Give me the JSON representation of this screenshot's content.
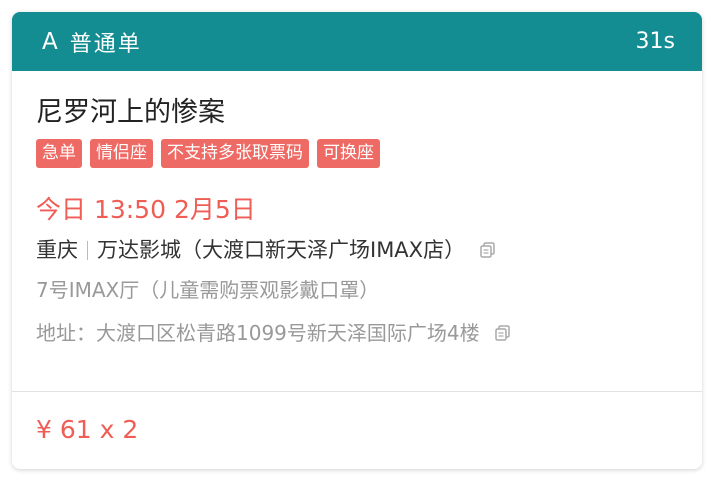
{
  "header": {
    "grade": "A",
    "order_type": "普通单",
    "countdown": "31s"
  },
  "movie": {
    "title": "尼罗河上的惨案"
  },
  "tags": [
    "急单",
    "情侣座",
    "不支持多张取票码",
    "可换座"
  ],
  "showtime": "今日 13:50 2月5日",
  "cinema": {
    "city": "重庆",
    "name": "万达影城（大渡口新天泽广场IMAX店）",
    "hall": "7号IMAX厅（儿童需购票观影戴口罩）",
    "address": "地址：大渡口区松青路1099号新天泽国际广场4楼"
  },
  "price": "¥ 61 x 2",
  "colors": {
    "header_bg": "#138c92",
    "tag_bg": "#ee6a64",
    "accent_red": "#ef5d55"
  },
  "icons": {
    "copy_cinema": "copy-icon",
    "copy_address": "copy-icon"
  }
}
